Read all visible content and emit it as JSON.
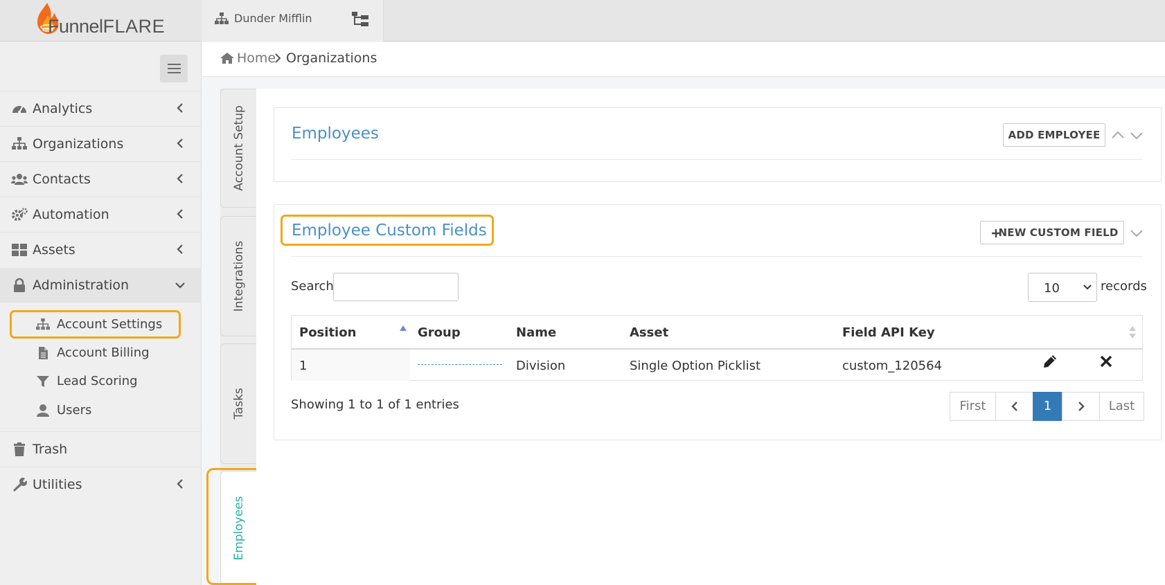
{
  "app": {
    "logo_text_1": "Funnel",
    "logo_text_2": "FLARE",
    "org_name": "Dunder Mifflin"
  },
  "breadcrumb": {
    "home": "Home",
    "current": "Organizations"
  },
  "sidebar": {
    "items": [
      {
        "label": "Analytics",
        "icon": "dashboard-icon"
      },
      {
        "label": "Organizations",
        "icon": "sitemap-icon"
      },
      {
        "label": "Contacts",
        "icon": "users-icon"
      },
      {
        "label": "Automation",
        "icon": "cogs-icon"
      },
      {
        "label": "Assets",
        "icon": "grid-icon"
      },
      {
        "label": "Administration",
        "icon": "lock-icon"
      },
      {
        "label": "Trash",
        "icon": "trash-icon"
      },
      {
        "label": "Utilities",
        "icon": "wrench-icon"
      }
    ],
    "sub_items": [
      {
        "label": "Account Settings",
        "icon": "sitemap-icon"
      },
      {
        "label": "Account Billing",
        "icon": "file-icon"
      },
      {
        "label": "Lead Scoring",
        "icon": "filter-icon"
      },
      {
        "label": "Users",
        "icon": "user-icon"
      }
    ]
  },
  "vertical_tabs": [
    {
      "label": "Account Setup"
    },
    {
      "label": "Integrations"
    },
    {
      "label": "Tasks"
    },
    {
      "label": "Employees"
    }
  ],
  "employees_panel": {
    "title": "Employees",
    "add_button": "ADD EMPLOYEE"
  },
  "custom_fields_panel": {
    "title": "Employee Custom Fields",
    "new_button": "NEW CUSTOM FIELD",
    "search_label": "Search:",
    "search_value": "",
    "page_length": "10",
    "records_label": "records",
    "columns": [
      "Position",
      "Group",
      "Name",
      "Asset",
      "Field API Key"
    ],
    "rows": [
      {
        "position": "1",
        "group": "",
        "name": "Division",
        "asset": "Single Option Picklist",
        "api_key": "custom_120564"
      }
    ],
    "showing": "Showing 1 to 1 of 1 entries",
    "pager": {
      "first": "First",
      "current": "1",
      "last": "Last"
    }
  },
  "colors": {
    "accent": "#4a90c8",
    "highlight": "#f2a818",
    "active_tab": "#27b3a0",
    "page_active": "#337ab7"
  }
}
